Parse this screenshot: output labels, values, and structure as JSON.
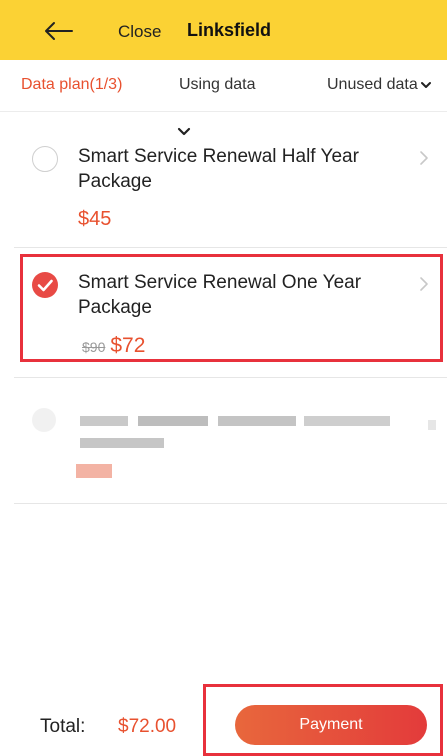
{
  "header": {
    "close_label": "Close",
    "title": "Linksfield",
    "background_color": "#fbd234"
  },
  "tabs": [
    {
      "label": "Data plan(1/3)",
      "active": true
    },
    {
      "label": "Using data",
      "active": false
    },
    {
      "label": "Unused data",
      "active": false
    }
  ],
  "packages": [
    {
      "name": "Smart Service Renewal Half Year Package",
      "price": "$45",
      "selected": false
    },
    {
      "name": "Smart Service Renewal One Year Package",
      "old_price": "$90",
      "price": "$72",
      "selected": true
    }
  ],
  "footer": {
    "total_label": "Total:",
    "total_value": "$72.00",
    "payment_label": "Payment"
  },
  "colors": {
    "accent": "#e8512f",
    "highlight": "#e8313c"
  },
  "icons": {
    "back": "arrow-left-icon",
    "tab_dropdown": "chevron-down-icon",
    "collapse": "chevron-down-icon",
    "package_arrow": "chevron-right-icon",
    "selected": "check-circle-icon"
  }
}
